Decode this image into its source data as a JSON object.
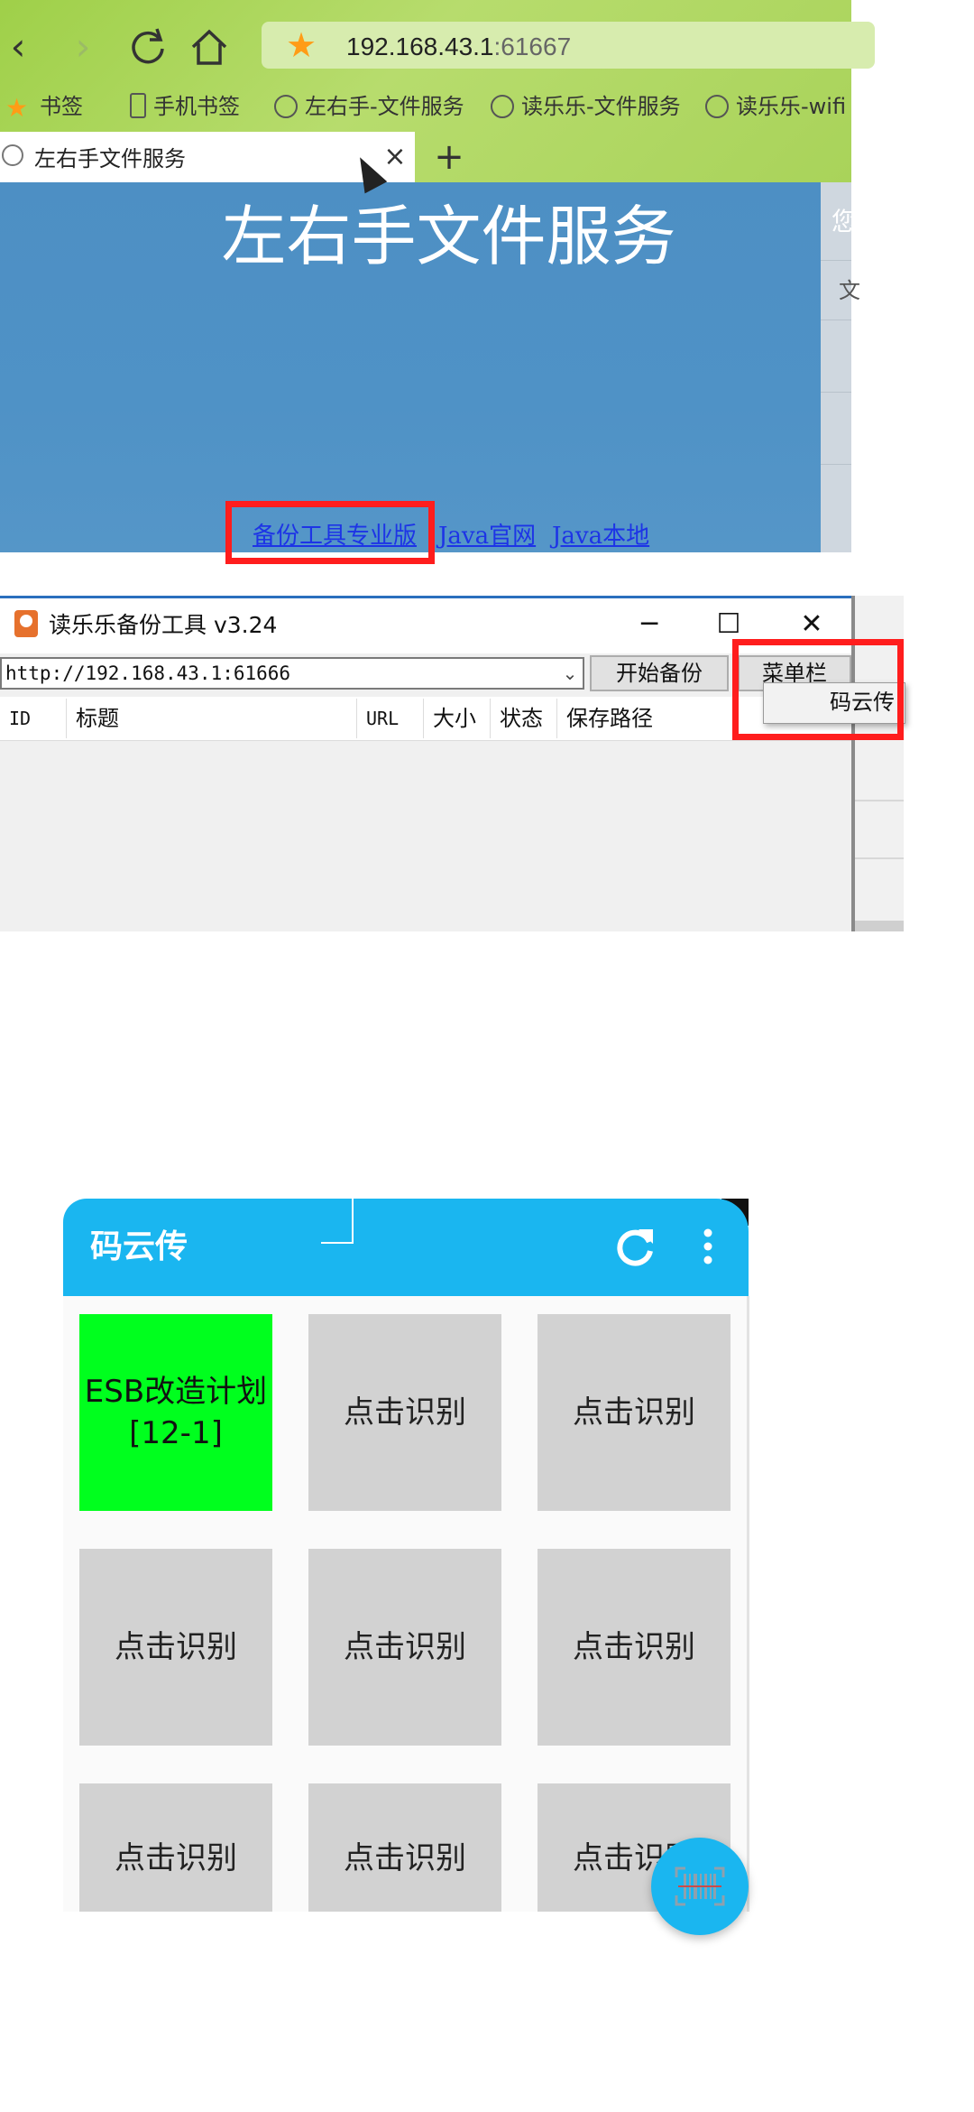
{
  "browser": {
    "address_host": "192.168.43.1",
    "address_port": ":61667",
    "bookmarks": [
      "书签",
      "手机书签",
      "左右手-文件服务",
      "读乐乐-文件服务",
      "读乐乐-wifi"
    ],
    "tab_title": "左右手文件服务",
    "tab_close": "×",
    "tab_new": "+",
    "page_title": "左右手文件服务",
    "links": [
      "备份工具专业版",
      "Java官网",
      "Java本地"
    ],
    "side_letters": [
      "您",
      "文"
    ]
  },
  "app": {
    "title": "读乐乐备份工具 v3.24",
    "url_value": "http://192.168.43.1:61666",
    "start_button": "开始备份",
    "menu_button": "菜单栏",
    "menu_item": "码云传",
    "columns": [
      "ID",
      "标题",
      "URL",
      "大小",
      "状态",
      "保存路径"
    ],
    "win_min": "─",
    "win_max": "☐",
    "win_close": "✕"
  },
  "phone": {
    "title": "码云传",
    "tiles": [
      "ESB改造计划 [12-1]",
      "点击识别",
      "点击识别",
      "点击识别",
      "点击识别",
      "点击识别",
      "点击识别",
      "点击识别",
      "点击识别"
    ],
    "accent": "#1ab6f0",
    "highlight_tile": "#00ff1e"
  }
}
